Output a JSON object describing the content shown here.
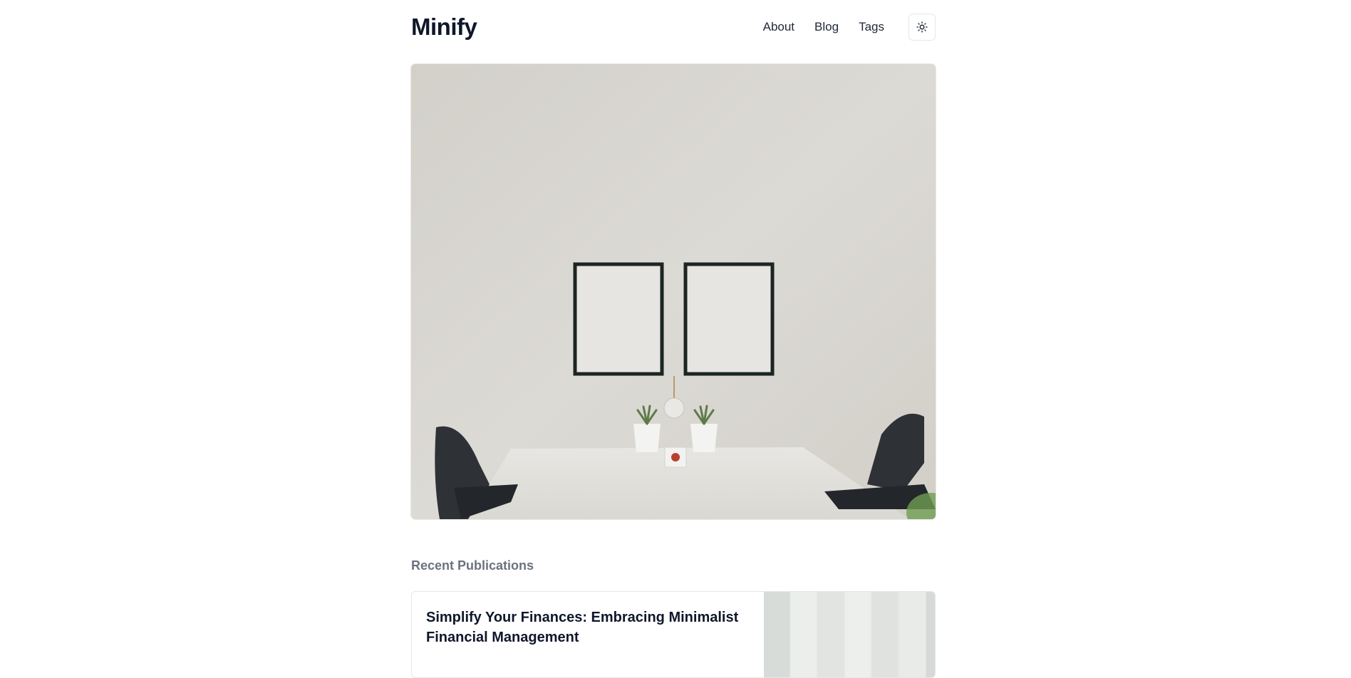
{
  "site": {
    "logo": "Minify"
  },
  "nav": {
    "items": [
      {
        "label": "About"
      },
      {
        "label": "Blog"
      },
      {
        "label": "Tags"
      }
    ],
    "theme_toggle_icon": "sun-icon"
  },
  "hero": {
    "image": "minimalist-room-photo"
  },
  "recent": {
    "title": "Recent Publications",
    "posts": [
      {
        "title": "Simplify Your Finances: Embracing Minimalist Financial Management",
        "thumbnail": "white-wall-panels-photo"
      }
    ]
  },
  "colors": {
    "text": "#0f172a",
    "muted": "#6b7280",
    "border": "#e5e7eb"
  }
}
